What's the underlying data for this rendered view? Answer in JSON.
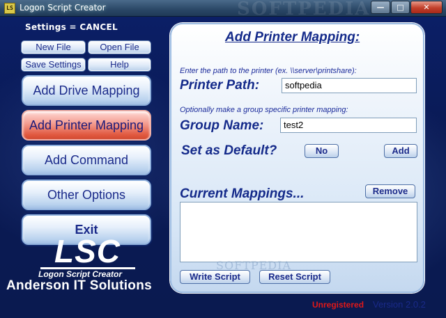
{
  "window": {
    "title": "Logon Script Creator",
    "icon_text": "LS",
    "watermark": "SOFTPEDIA",
    "min_glyph": "—",
    "max_glyph": "□",
    "close_glyph": "✕"
  },
  "status": {
    "settings": "Settings = CANCEL",
    "unregistered": "Unregistered",
    "version": "Version 2.0.2"
  },
  "toolbar": {
    "new_file": "New File",
    "open_file": "Open File",
    "save_settings": "Save Settings",
    "help": "Help"
  },
  "nav": {
    "add_drive_mapping": "Add Drive Mapping",
    "add_printer_mapping": "Add Printer Mapping",
    "add_command": "Add Command",
    "other_options": "Other Options",
    "exit": "Exit"
  },
  "logo": {
    "mark": "LSC",
    "subtitle": "Logon Script Creator",
    "company": "Anderson IT Solutions"
  },
  "panel": {
    "title": "Add Printer Mapping:",
    "path_hint": "Enter the path to the printer (ex. \\\\server\\printshare):",
    "printer_path_label": "Printer Path:",
    "printer_path_value": "softpedia",
    "group_hint": "Optionally make a group specific printer mapping:",
    "group_name_label": "Group Name:",
    "group_name_value": "test2",
    "default_label": "Set as Default?",
    "default_value": "No",
    "add_button": "Add",
    "mappings_label": "Current Mappings...",
    "remove_button": "Remove",
    "write_script_button": "Write Script",
    "reset_script_button": "Reset Script",
    "watermark": "SOFTPEDIA"
  },
  "colors": {
    "background": "#0a1a55",
    "panel": "#e6eff9",
    "active_button": "#e0583f",
    "text_blue": "#142a8a",
    "unregistered": "#e01818"
  }
}
